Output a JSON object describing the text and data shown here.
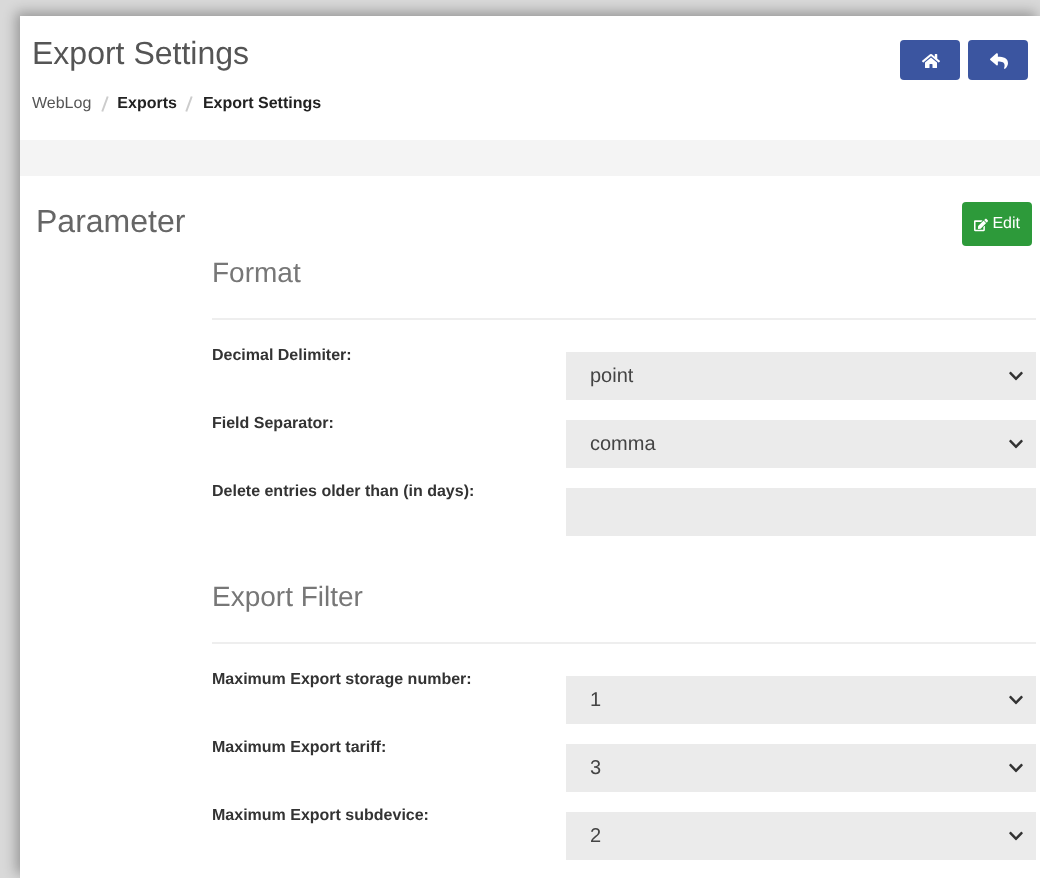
{
  "page": {
    "title": "Export Settings",
    "breadcrumb": [
      {
        "label": "WebLog",
        "current": false
      },
      {
        "label": "Exports",
        "current": true
      },
      {
        "label": "Export Settings",
        "current": true
      }
    ]
  },
  "panel": {
    "title": "Parameter",
    "edit_button": "Edit"
  },
  "sections": [
    {
      "title": "Format",
      "fields": [
        {
          "label": "Decimal Delimiter:",
          "kind": "select",
          "value": "point"
        },
        {
          "label": "Field Separator:",
          "kind": "select",
          "value": "comma"
        },
        {
          "label": "Delete entries older than (in days):",
          "kind": "input"
        }
      ]
    },
    {
      "title": "Export Filter",
      "fields": [
        {
          "label": "Maximum Export storage number:",
          "kind": "select",
          "value": "1"
        },
        {
          "label": "Maximum Export tariff:",
          "kind": "select",
          "value": "3"
        },
        {
          "label": "Maximum Export subdevice:",
          "kind": "select",
          "value": "2"
        }
      ]
    }
  ]
}
